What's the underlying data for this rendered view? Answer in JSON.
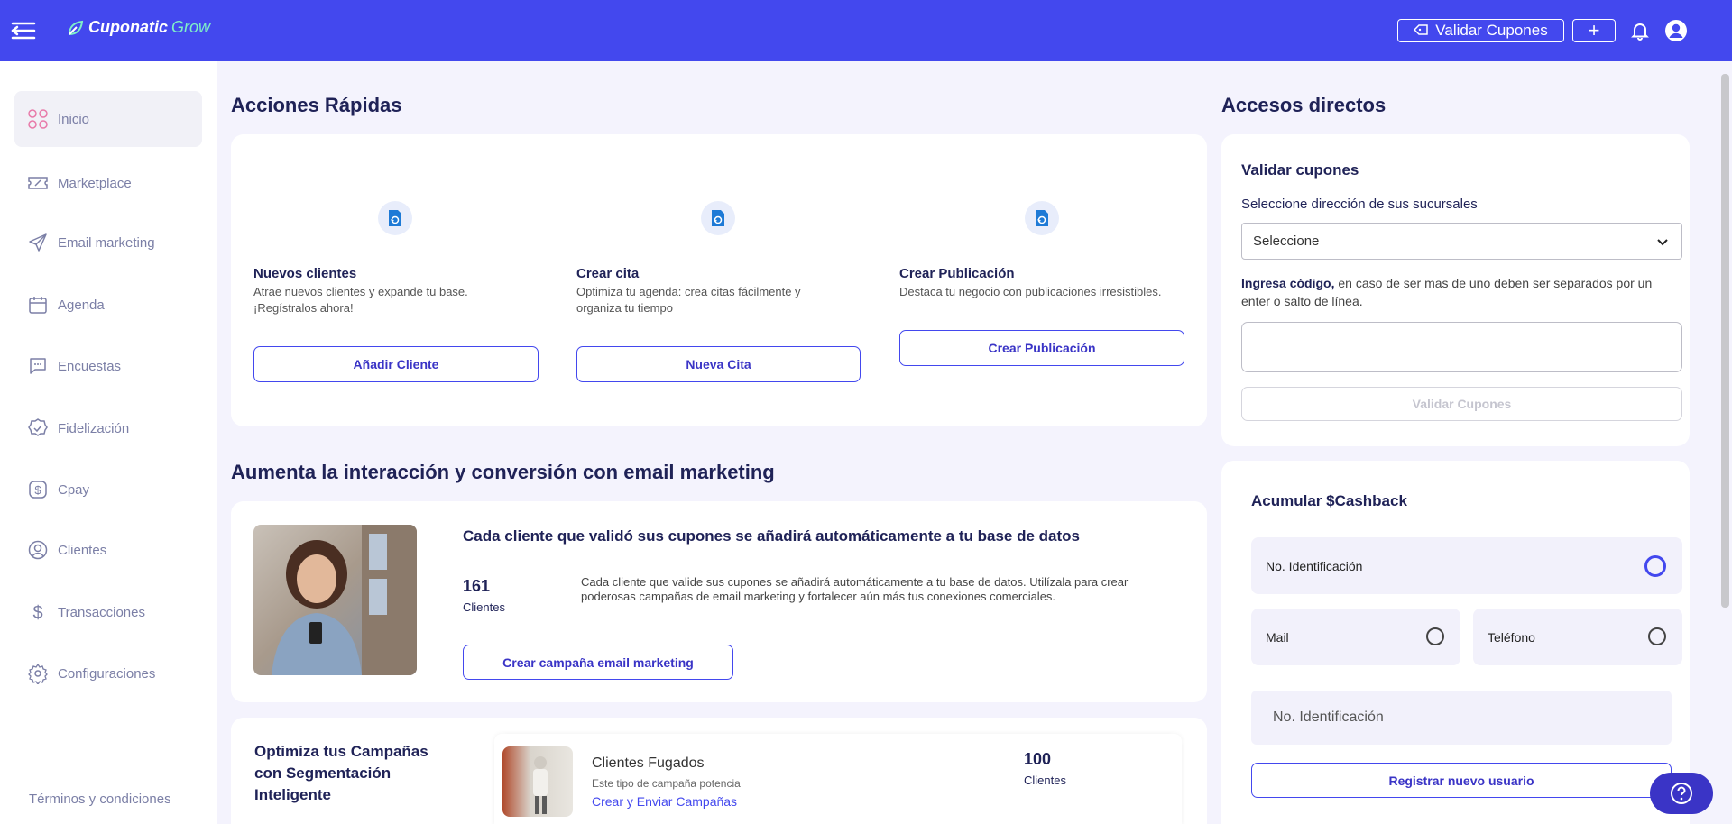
{
  "topbar": {
    "brand_main": "Cuponatic",
    "brand_sub": "Grow",
    "validar_label": "Validar Cupones",
    "plus_label": "+"
  },
  "sidebar": {
    "items": [
      {
        "label": "Inicio",
        "icon": "grid-icon"
      },
      {
        "label": "Marketplace",
        "icon": "ticket-icon"
      },
      {
        "label": "Email marketing",
        "icon": "paper-plane-icon"
      },
      {
        "label": "Agenda",
        "icon": "calendar-icon"
      },
      {
        "label": "Encuestas",
        "icon": "chat-icon"
      },
      {
        "label": "Fidelización",
        "icon": "badge-check-icon"
      },
      {
        "label": "Cpay",
        "icon": "dollar-box-icon"
      },
      {
        "label": "Clientes",
        "icon": "user-circle-icon"
      },
      {
        "label": "Transacciones",
        "icon": "dollar-icon"
      },
      {
        "label": "Configuraciones",
        "icon": "gear-icon"
      }
    ],
    "terms": "Términos y condiciones"
  },
  "quick_actions": {
    "title": "Acciones Rápidas",
    "cards": [
      {
        "title": "Nuevos clientes",
        "desc1": "Atrae nuevos clientes y expande tu base.",
        "desc2": "¡Regístralos ahora!",
        "button": "Añadir Cliente"
      },
      {
        "title": "Crear cita",
        "desc1": "Optimiza tu agenda: crea citas fácilmente y",
        "desc2": "organiza tu tiempo",
        "button": "Nueva Cita"
      },
      {
        "title": "Crear Publicación",
        "desc1": "Destaca tu negocio con publicaciones irresistibles.",
        "desc2": "",
        "button": "Crear Publicación"
      }
    ]
  },
  "email_section": {
    "title": "Aumenta la interacción y conversión con email marketing",
    "card_title": "Cada cliente que validó sus cupones se añadirá automáticamente a tu base de datos",
    "count": "161",
    "count_label": "Clientes",
    "desc1": "Cada cliente que valide sus cupones se añadirá automáticamente a tu base de datos. Utilízala para crear",
    "desc2": "poderosas campañas de email marketing y fortalecer aún más tus conexiones comerciales.",
    "button": "Crear campaña email marketing"
  },
  "segmentation": {
    "title1": "Optimiza tus Campañas",
    "title2": "con Segmentación",
    "title3": "Inteligente",
    "campaign_name": "Clientes Fugados",
    "campaign_desc": "Este tipo de campaña potencia",
    "campaign_link": "Crear y Enviar Campañas",
    "count": "100",
    "count_label": "Clientes"
  },
  "direct_access": {
    "title": "Accesos directos",
    "validate": {
      "title": "Validar cupones",
      "select_label": "Seleccione dirección de sus sucursales",
      "select_value": "Seleccione",
      "code_bold": "Ingresa código,",
      "code_rest1": " en caso de ser mas de uno deben ser separados por un",
      "code_rest2": "enter o salto de línea.",
      "button": "Validar Cupones"
    },
    "cashback": {
      "title": "Acumular $Cashback",
      "options": [
        "No. Identificación",
        "Mail",
        "Teléfono"
      ],
      "selected": "No. Identificación",
      "input_placeholder": "No. Identificación",
      "button": "Registrar nuevo usuario"
    }
  },
  "colors": {
    "primary": "#4348ee",
    "accent": "#3a34c6",
    "background": "#f4f3fd"
  }
}
